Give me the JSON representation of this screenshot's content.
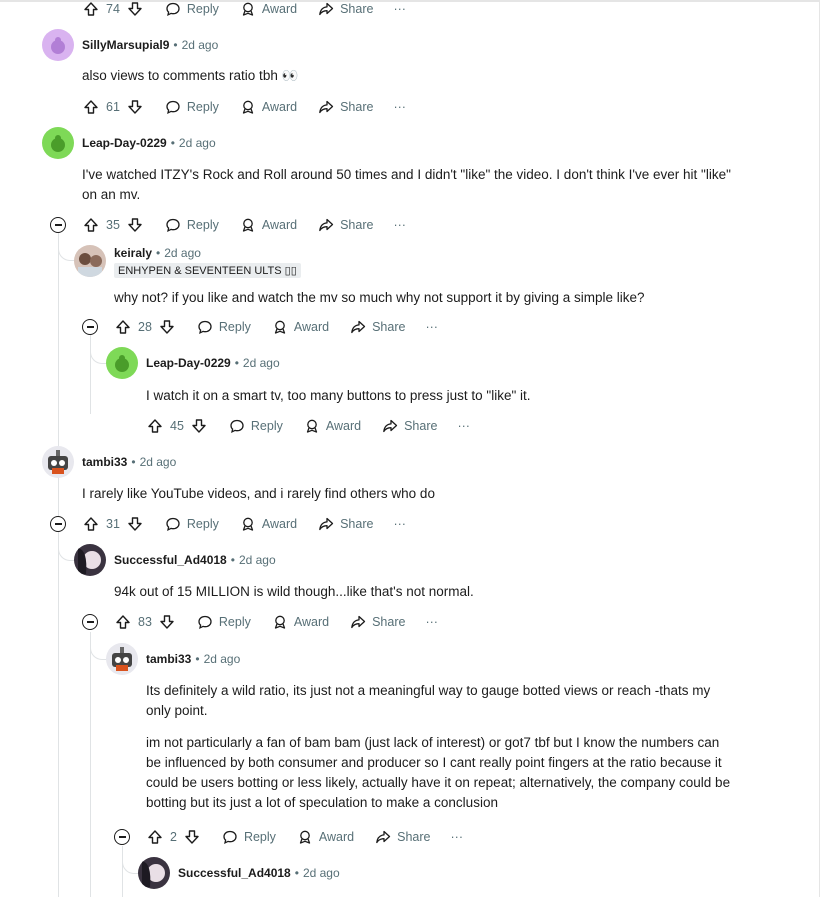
{
  "labels": {
    "reply": "Reply",
    "award": "Award",
    "share": "Share",
    "more": "···"
  },
  "top_actions": {
    "score": "74"
  },
  "comments": [
    {
      "author": "SillyMarsupial9",
      "time": "2d ago",
      "body": [
        "also views to comments ratio tbh 👀"
      ],
      "score": "61"
    },
    {
      "author": "Leap-Day-0229",
      "time": "2d ago",
      "body": [
        "I've watched ITZY's Rock and Roll around 50 times and I didn't \"like\" the video. I don't think I've ever hit \"like\" on an mv."
      ],
      "score": "35"
    },
    {
      "author": "keiraly",
      "time": "2d ago",
      "flair": "ENHYPEN & SEVENTEEN ULTS ▯▯",
      "body": [
        "why not? if you like and watch the mv so much why not support it by giving a simple like?"
      ],
      "score": "28"
    },
    {
      "author": "Leap-Day-0229",
      "time": "2d ago",
      "body": [
        "I watch it on a smart tv, too many buttons to press just to \"like\" it."
      ],
      "score": "45"
    },
    {
      "author": "tambi33",
      "time": "2d ago",
      "body": [
        "I rarely like YouTube videos, and i rarely find others who do"
      ],
      "score": "31"
    },
    {
      "author": "Successful_Ad4018",
      "time": "2d ago",
      "body": [
        "94k out of 15 MILLION is wild though...like that's not normal."
      ],
      "score": "83"
    },
    {
      "author": "tambi33",
      "time": "2d ago",
      "body": [
        "Its definitely a wild ratio, its just not a meaningful way to gauge botted views or reach -thats my only point.",
        "im not particularly a fan of bam bam (just lack of interest) or got7 tbf but I know the numbers can be influenced by both consumer and producer so I cant really point fingers at the ratio because it could be users botting or less likely, actually have it on repeat; alternatively, the company could be botting but its just a lot of speculation to make a conclusion"
      ],
      "score": "2"
    },
    {
      "author": "Successful_Ad4018",
      "time": "2d ago"
    }
  ]
}
